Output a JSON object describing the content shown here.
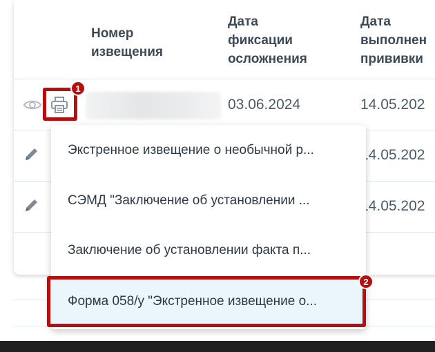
{
  "table": {
    "headers": {
      "notice_number": "Номер\nизвещения",
      "fixation_date": "Дата\nфиксации\nосложнения",
      "vaccination_date": "Дата\nвыполнен\nпрививки"
    },
    "rows": [
      {
        "fixation_date": "03.06.2024",
        "vaccination_date": "14.05.202"
      },
      {
        "vaccination_date": "14.05.202"
      },
      {
        "vaccination_date": "14.05.202"
      }
    ]
  },
  "menu": {
    "items": [
      {
        "label": "Экстренное извещение о необычной р..."
      },
      {
        "label": "СЭМД \"Заключение об установлении ..."
      },
      {
        "label": "Заключение об установлении факта п..."
      },
      {
        "label": "Форма 058/у \"Экстренное извещение о..."
      }
    ],
    "selected_index": 3
  },
  "annotations": {
    "badge_1": "1",
    "badge_2": "2"
  },
  "colors": {
    "highlight": "#b50f0f",
    "selected_bg": "#eaf6fb",
    "icon": "#8a97a3"
  },
  "icons": {
    "view": "eye-icon",
    "print": "printer-icon",
    "edit": "pencil-icon"
  }
}
